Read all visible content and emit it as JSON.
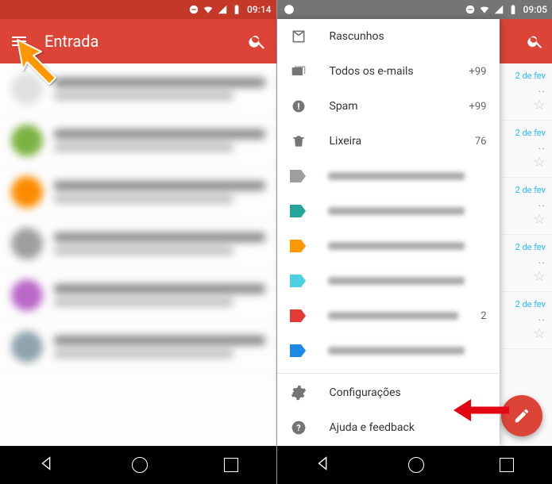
{
  "left": {
    "status_time": "09:14",
    "appbar_title": "Entrada",
    "inbox_rows": [
      {
        "avatar_color": "#e0e0e0"
      },
      {
        "avatar_color": "#7cb342"
      },
      {
        "avatar_color": "#fb8c00"
      },
      {
        "avatar_color": "#9e9e9e"
      },
      {
        "avatar_color": "#ba68c8"
      },
      {
        "avatar_color": "#90a4ae"
      }
    ]
  },
  "right": {
    "status_time": "09:05",
    "drawer_items": [
      {
        "icon": "drafts",
        "label": "Rascunhos",
        "count": ""
      },
      {
        "icon": "allmail",
        "label": "Todos os e-mails",
        "count": "+99"
      },
      {
        "icon": "spam",
        "label": "Spam",
        "count": "+99"
      },
      {
        "icon": "trash",
        "label": "Lixeira",
        "count": "76"
      },
      {
        "icon": "label",
        "label_blurred": true,
        "color": "#9e9e9e",
        "count": ""
      },
      {
        "icon": "label",
        "label_blurred": true,
        "color": "#26a69a",
        "count": ""
      },
      {
        "icon": "label",
        "label_blurred": true,
        "color": "#ff9800",
        "count": ""
      },
      {
        "icon": "label",
        "label_blurred": true,
        "color": "#4dd0e1",
        "count": ""
      },
      {
        "icon": "label",
        "label_blurred": true,
        "color": "#e53935",
        "count": "2"
      },
      {
        "icon": "label",
        "label_blurred": true,
        "color": "#1e88e5",
        "count": ""
      }
    ],
    "footer": [
      {
        "icon": "settings",
        "label": "Configurações"
      },
      {
        "icon": "help",
        "label": "Ajuda e feedback"
      }
    ],
    "sliver_date": "2 de fev"
  }
}
